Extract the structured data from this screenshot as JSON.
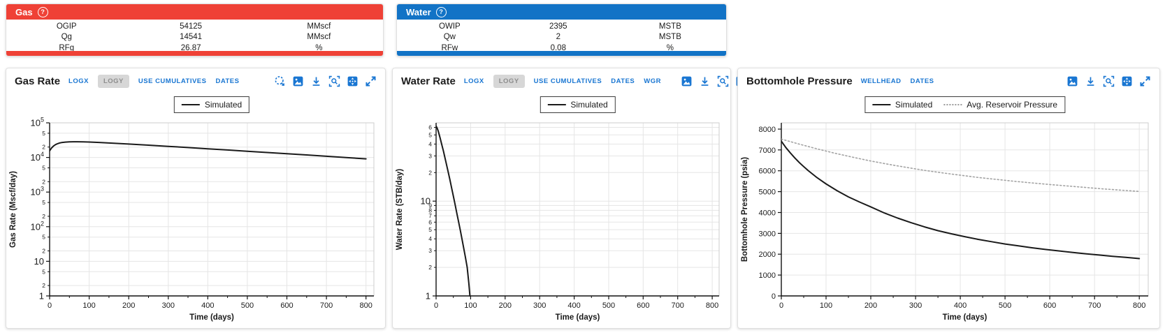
{
  "colors": {
    "gas_red": "#EF4136",
    "water_blue": "#1273C6",
    "accent_blue": "#1976D2",
    "grid": "#e5e5e5",
    "axis": "#111111",
    "series_black": "#1a1a1a",
    "series_dotted_gray": "#a3a3a3",
    "toggle_active_bg": "#d7d7d7"
  },
  "summary_cards": [
    {
      "title": "Gas",
      "help_icon": "?",
      "color": "#EF4136",
      "rows": [
        {
          "label": "OGIP",
          "value": "54125",
          "unit": "MMscf"
        },
        {
          "label": "Qg",
          "value": "14541",
          "unit": "MMscf"
        },
        {
          "label": "RFg",
          "value": "26.87",
          "unit": "%"
        }
      ]
    },
    {
      "title": "Water",
      "help_icon": "?",
      "color": "#1273C6",
      "rows": [
        {
          "label": "OWIP",
          "value": "2395",
          "unit": "MSTB"
        },
        {
          "label": "Qw",
          "value": "2",
          "unit": "MSTB"
        },
        {
          "label": "RFw",
          "value": "0.08",
          "unit": "%"
        }
      ]
    }
  ],
  "chart_data": [
    {
      "type": "line",
      "title": "Gas Rate",
      "toolbar": [
        {
          "label": "LOGX",
          "active": false
        },
        {
          "label": "LOGY",
          "active": true
        },
        {
          "label": "USE CUMULATIVES",
          "active": false
        },
        {
          "label": "DATES",
          "active": false
        }
      ],
      "icons": [
        "lasso-select",
        "export-image",
        "download",
        "zoom-region",
        "pan-arrows",
        "fullscreen"
      ],
      "xlabel": "Time (days)",
      "ylabel": "Gas Rate (Mscf/day)",
      "xscale": "linear",
      "yscale": "log",
      "xlim": [
        0,
        820
      ],
      "xticks": [
        0,
        100,
        200,
        300,
        400,
        500,
        600,
        700,
        800
      ],
      "x_minor_step": 50,
      "ylim": [
        1,
        100000
      ],
      "ytick_minor_labels": [
        2,
        5
      ],
      "grid": true,
      "legend_pos": "top-center",
      "legend": [
        {
          "label": "Simulated",
          "style": "solid",
          "color": "#1a1a1a"
        }
      ],
      "series": [
        {
          "name": "Simulated",
          "style": "solid",
          "color": "#1a1a1a",
          "width": 2,
          "points": [
            [
              0,
              15500
            ],
            [
              5,
              18800
            ],
            [
              10,
              21500
            ],
            [
              15,
              23500
            ],
            [
              20,
              25000
            ],
            [
              25,
              26100
            ],
            [
              30,
              26900
            ],
            [
              40,
              27800
            ],
            [
              50,
              28200
            ],
            [
              60,
              28400
            ],
            [
              70,
              28400
            ],
            [
              85,
              28200
            ],
            [
              100,
              27900
            ],
            [
              125,
              27100
            ],
            [
              150,
              26200
            ],
            [
              175,
              25300
            ],
            [
              200,
              24400
            ],
            [
              250,
              22600
            ],
            [
              300,
              20900
            ],
            [
              350,
              19300
            ],
            [
              400,
              17800
            ],
            [
              450,
              16400
            ],
            [
              500,
              15100
            ],
            [
              550,
              13900
            ],
            [
              600,
              12800
            ],
            [
              650,
              11800
            ],
            [
              700,
              10800
            ],
            [
              750,
              9900
            ],
            [
              800,
              9100
            ]
          ]
        }
      ]
    },
    {
      "type": "line",
      "title": "Water Rate",
      "toolbar": [
        {
          "label": "LOGX",
          "active": false
        },
        {
          "label": "LOGY",
          "active": true
        },
        {
          "label": "USE CUMULATIVES",
          "active": false
        },
        {
          "label": "DATES",
          "active": false
        },
        {
          "label": "WGR",
          "active": false
        }
      ],
      "icons": [
        "export-image",
        "download",
        "zoom-region",
        "pan-arrows",
        "fullscreen"
      ],
      "xlabel": "Time (days)",
      "ylabel": "Water Rate (STB/day)",
      "xscale": "linear",
      "yscale": "log",
      "xlim": [
        0,
        820
      ],
      "xticks": [
        0,
        100,
        200,
        300,
        400,
        500,
        600,
        700,
        800
      ],
      "x_minor_step": 50,
      "ylim": [
        1,
        67
      ],
      "ytick_minor_labels": [
        2,
        3,
        4,
        5,
        6,
        7,
        8,
        9
      ],
      "grid": true,
      "legend_pos": "top-center",
      "legend": [
        {
          "label": "Simulated",
          "style": "solid",
          "color": "#1a1a1a"
        }
      ],
      "series": [
        {
          "name": "Simulated",
          "style": "solid",
          "color": "#1a1a1a",
          "width": 2,
          "points": [
            [
              0,
              62
            ],
            [
              3,
              59
            ],
            [
              6,
              55
            ],
            [
              9,
              50.5
            ],
            [
              12,
              46
            ],
            [
              15,
              41.5
            ],
            [
              18,
              37.5
            ],
            [
              21,
              34
            ],
            [
              25,
              29.5
            ],
            [
              30,
              24.5
            ],
            [
              35,
              20.3
            ],
            [
              40,
              16.8
            ],
            [
              45,
              13.8
            ],
            [
              50,
              11.3
            ],
            [
              55,
              9.2
            ],
            [
              60,
              7.5
            ],
            [
              65,
              6.1
            ],
            [
              70,
              4.95
            ],
            [
              75,
              4.0
            ],
            [
              80,
              3.2
            ],
            [
              85,
              2.55
            ],
            [
              90,
              2.0
            ],
            [
              95,
              1.35
            ],
            [
              98,
              1.0
            ]
          ]
        }
      ]
    },
    {
      "type": "line",
      "title": "Bottomhole Pressure",
      "toolbar": [
        {
          "label": "WELLHEAD",
          "active": false
        },
        {
          "label": "DATES",
          "active": false
        }
      ],
      "icons": [
        "export-image",
        "download",
        "zoom-region",
        "pan-arrows",
        "fullscreen"
      ],
      "xlabel": "Time (days)",
      "ylabel": "Bottomhole Pressure (psia)",
      "xscale": "linear",
      "yscale": "linear",
      "xlim": [
        0,
        820
      ],
      "xticks": [
        0,
        100,
        200,
        300,
        400,
        500,
        600,
        700,
        800
      ],
      "x_minor_step": 50,
      "ylim": [
        0,
        8300
      ],
      "yticks": [
        0,
        1000,
        2000,
        3000,
        4000,
        5000,
        6000,
        7000,
        8000
      ],
      "grid": true,
      "legend_pos": "top-center",
      "legend": [
        {
          "label": "Simulated",
          "style": "solid",
          "color": "#1a1a1a"
        },
        {
          "label": "Avg. Reservoir Pressure",
          "style": "dotted",
          "color": "#a3a3a3"
        }
      ],
      "series": [
        {
          "name": "Simulated",
          "style": "solid",
          "color": "#1a1a1a",
          "width": 2,
          "points": [
            [
              0,
              7420
            ],
            [
              10,
              7120
            ],
            [
              20,
              6860
            ],
            [
              30,
              6620
            ],
            [
              40,
              6400
            ],
            [
              50,
              6200
            ],
            [
              60,
              6010
            ],
            [
              80,
              5670
            ],
            [
              100,
              5370
            ],
            [
              125,
              5040
            ],
            [
              150,
              4750
            ],
            [
              175,
              4500
            ],
            [
              200,
              4270
            ],
            [
              230,
              3980
            ],
            [
              260,
              3730
            ],
            [
              290,
              3510
            ],
            [
              320,
              3310
            ],
            [
              350,
              3130
            ],
            [
              380,
              2980
            ],
            [
              410,
              2840
            ],
            [
              440,
              2710
            ],
            [
              470,
              2600
            ],
            [
              500,
              2490
            ],
            [
              530,
              2400
            ],
            [
              560,
              2310
            ],
            [
              590,
              2230
            ],
            [
              620,
              2160
            ],
            [
              650,
              2090
            ],
            [
              680,
              2020
            ],
            [
              710,
              1960
            ],
            [
              740,
              1900
            ],
            [
              770,
              1850
            ],
            [
              800,
              1790
            ]
          ]
        },
        {
          "name": "Avg. Reservoir Pressure",
          "style": "dotted",
          "color": "#a3a3a3",
          "width": 1.6,
          "points": [
            [
              0,
              7520
            ],
            [
              40,
              7280
            ],
            [
              80,
              7050
            ],
            [
              120,
              6840
            ],
            [
              160,
              6650
            ],
            [
              200,
              6470
            ],
            [
              240,
              6310
            ],
            [
              280,
              6160
            ],
            [
              320,
              6020
            ],
            [
              360,
              5900
            ],
            [
              400,
              5790
            ],
            [
              440,
              5680
            ],
            [
              480,
              5590
            ],
            [
              520,
              5500
            ],
            [
              560,
              5420
            ],
            [
              600,
              5340
            ],
            [
              640,
              5270
            ],
            [
              680,
              5200
            ],
            [
              720,
              5130
            ],
            [
              760,
              5070
            ],
            [
              800,
              5010
            ]
          ]
        }
      ]
    }
  ]
}
